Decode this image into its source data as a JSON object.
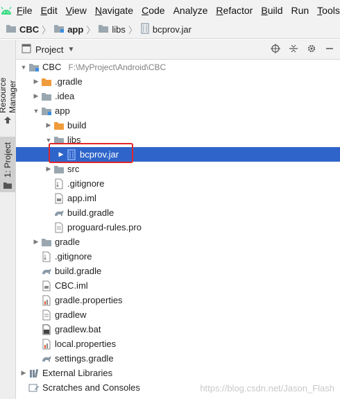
{
  "menu": {
    "items": [
      {
        "key": "F",
        "rest": "ile"
      },
      {
        "key": "E",
        "rest": "dit"
      },
      {
        "key": "V",
        "rest": "iew"
      },
      {
        "key": "N",
        "rest": "avigate"
      },
      {
        "key": "C",
        "rest": "ode"
      },
      {
        "key": "",
        "rest": "Analyze"
      },
      {
        "key": "R",
        "rest": "efactor"
      },
      {
        "key": "B",
        "rest": "uild"
      },
      {
        "key": "",
        "rest": "Run"
      },
      {
        "key": "T",
        "rest": "ools"
      }
    ]
  },
  "breadcrumb": [
    "CBC",
    "app",
    "libs",
    "bcprov.jar"
  ],
  "toolstrip": {
    "resource_manager": "Resource Manager",
    "project_tab": "1: Project"
  },
  "panel": {
    "title": "Project"
  },
  "tree": [
    {
      "label": "CBC",
      "path": "F:\\MyProject\\Android\\CBC",
      "indent": 0,
      "arrow": "down",
      "icon": "module-folder"
    },
    {
      "label": ".gradle",
      "indent": 1,
      "arrow": "right",
      "icon": "folder-orange"
    },
    {
      "label": ".idea",
      "indent": 1,
      "arrow": "right",
      "icon": "folder-grey"
    },
    {
      "label": "app",
      "indent": 1,
      "arrow": "down",
      "icon": "module-folder"
    },
    {
      "label": "build",
      "indent": 2,
      "arrow": "right",
      "icon": "folder-orange"
    },
    {
      "label": "libs",
      "indent": 2,
      "arrow": "down",
      "icon": "folder-grey"
    },
    {
      "label": "bcprov.jar",
      "indent": 3,
      "arrow": "right",
      "icon": "jar",
      "selected": true
    },
    {
      "label": "src",
      "indent": 2,
      "arrow": "right",
      "icon": "folder-grey"
    },
    {
      "label": ".gitignore",
      "indent": 2,
      "arrow": "",
      "icon": "gitignore"
    },
    {
      "label": "app.iml",
      "indent": 2,
      "arrow": "",
      "icon": "iml"
    },
    {
      "label": "build.gradle",
      "indent": 2,
      "arrow": "",
      "icon": "gradle"
    },
    {
      "label": "proguard-rules.pro",
      "indent": 2,
      "arrow": "",
      "icon": "file"
    },
    {
      "label": "gradle",
      "indent": 1,
      "arrow": "right",
      "icon": "folder-grey"
    },
    {
      "label": ".gitignore",
      "indent": 1,
      "arrow": "",
      "icon": "gitignore"
    },
    {
      "label": "build.gradle",
      "indent": 1,
      "arrow": "",
      "icon": "gradle"
    },
    {
      "label": "CBC.iml",
      "indent": 1,
      "arrow": "",
      "icon": "iml"
    },
    {
      "label": "gradle.properties",
      "indent": 1,
      "arrow": "",
      "icon": "properties"
    },
    {
      "label": "gradlew",
      "indent": 1,
      "arrow": "",
      "icon": "file"
    },
    {
      "label": "gradlew.bat",
      "indent": 1,
      "arrow": "",
      "icon": "bat"
    },
    {
      "label": "local.properties",
      "indent": 1,
      "arrow": "",
      "icon": "properties"
    },
    {
      "label": "settings.gradle",
      "indent": 1,
      "arrow": "",
      "icon": "gradle"
    },
    {
      "label": "External Libraries",
      "indent": 0,
      "arrow": "right",
      "icon": "libraries"
    },
    {
      "label": "Scratches and Consoles",
      "indent": 0,
      "arrow": "",
      "icon": "scratches"
    }
  ],
  "watermark": "https://blog.csdn.net/Jason_Flash"
}
